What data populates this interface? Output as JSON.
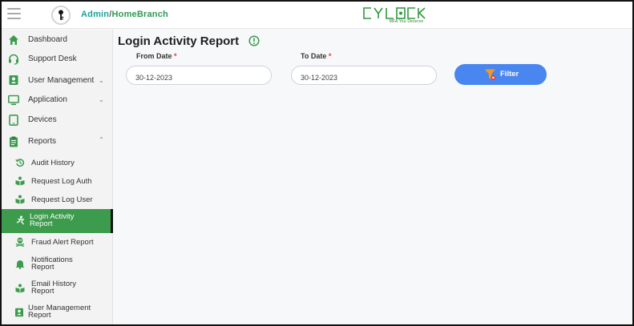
{
  "header": {
    "role": "Admin",
    "separator": "/",
    "branch": "HomeBranch",
    "logo_text": "CYLOCK",
    "logo_tagline": "MFA You Deserve"
  },
  "sidebar": {
    "items": [
      {
        "label": "Dashboard",
        "icon": "home-icon"
      },
      {
        "label": "Support Desk",
        "icon": "headset-icon"
      },
      {
        "label": "User Management",
        "icon": "id-card-icon",
        "chevron": "down"
      },
      {
        "label": "Application",
        "icon": "monitor-icon",
        "chevron": "down"
      },
      {
        "label": "Devices",
        "icon": "tablet-icon"
      },
      {
        "label": "Reports",
        "icon": "clipboard-icon",
        "chevron": "up"
      }
    ],
    "report_items": [
      {
        "label": "Audit History",
        "icon": "history-icon"
      },
      {
        "label": "Request Log Auth",
        "icon": "book-user-icon"
      },
      {
        "label": "Request Log User",
        "icon": "book-user-icon"
      },
      {
        "label_line1": "Login Activity",
        "label_line2": "Report",
        "icon": "login-activity-icon",
        "active": true
      },
      {
        "label": "Fraud Alert Report",
        "icon": "skull-icon"
      },
      {
        "label_line1": "Notifications",
        "label_line2": "Report",
        "icon": "bell-icon"
      },
      {
        "label_line1": "Email History",
        "label_line2": "Report",
        "icon": "book-user-icon"
      },
      {
        "label_line1": "User Management",
        "label_line2": "Report",
        "icon": "id-card-icon"
      }
    ]
  },
  "main": {
    "title": "Login Activity Report",
    "from_date": {
      "label": "From Date",
      "required_mark": "*",
      "value": "30-12-2023"
    },
    "to_date": {
      "label": "To Date",
      "required_mark": "*",
      "value": "30-12-2023"
    },
    "filter_button": {
      "label": "Filter"
    }
  },
  "colors": {
    "accent_green": "#3d9b4e",
    "filter_blue": "#4a86f0",
    "role_teal": "#1aa39a",
    "required_red": "#e53935"
  }
}
